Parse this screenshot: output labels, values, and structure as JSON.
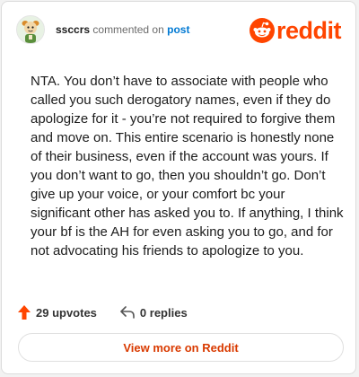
{
  "header": {
    "username": "ssccrs",
    "commented_text": "commented on",
    "post_link": "post",
    "logo_text": "reddit",
    "avatar_icon": "snoo-avatar-icon",
    "logo_icon": "reddit-snoo-icon"
  },
  "comment": {
    "body": "NTA. You don’t have to associate with people who called you such derogatory names, even if they do apologize for it - you’re not required to forgive them and move on. This entire scenario is honestly none of their business, even if the account was yours. If you don’t want to go, then you shouldn’t go. Don’t give up your voice, or your comfort bc your significant other has asked you to. If anything, I think your bf is the AH for even asking you to go, and for not advocating his friends to apologize to you."
  },
  "actions": {
    "upvotes_label": "29 upvotes",
    "replies_label": "0 replies",
    "upvote_icon": "upvote-arrow-icon",
    "reply_icon": "reply-arrow-icon"
  },
  "footer": {
    "view_more_label": "View more on Reddit"
  },
  "colors": {
    "brand": "#ff4500",
    "link": "#0079d3",
    "button_text": "#d93a00"
  }
}
